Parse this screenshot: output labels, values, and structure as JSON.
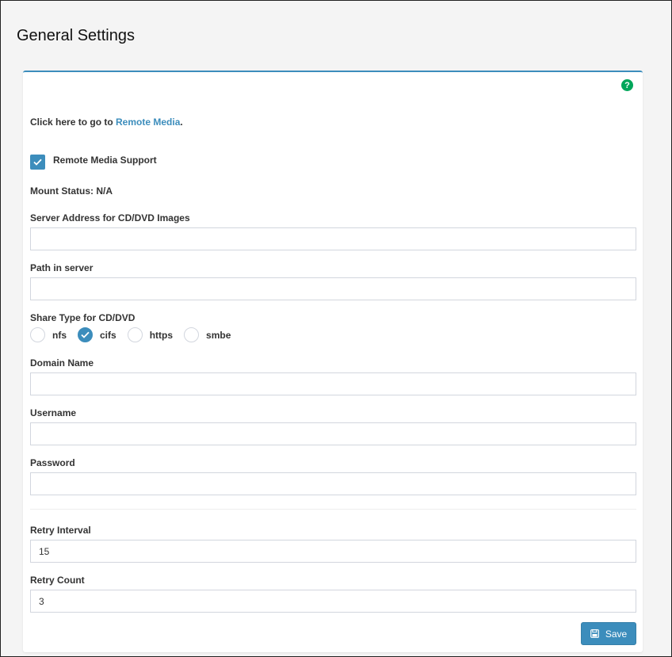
{
  "page": {
    "title": "General Settings"
  },
  "card": {
    "help_icon": "question-circle-icon",
    "link_prefix": "Click here to go to ",
    "link_text": "Remote Media",
    "link_suffix": ".",
    "remote_media_support": {
      "label": "Remote Media Support",
      "checked": true
    },
    "mount_status": "Mount Status: N/A",
    "fields": {
      "server_address": {
        "label": "Server Address for CD/DVD Images",
        "value": ""
      },
      "path_in_server": {
        "label": "Path in server",
        "value": ""
      },
      "domain_name": {
        "label": "Domain Name",
        "value": ""
      },
      "username": {
        "label": "Username",
        "value": ""
      },
      "password": {
        "label": "Password",
        "value": ""
      },
      "retry_interval": {
        "label": "Retry Interval",
        "value": "15"
      },
      "retry_count": {
        "label": "Retry Count",
        "value": "3"
      }
    },
    "share_type": {
      "label": "Share Type for CD/DVD",
      "options": [
        "nfs",
        "cifs",
        "https",
        "smbe"
      ],
      "selected": "cifs"
    },
    "save_label": "Save",
    "save_icon": "floppy-disk-icon"
  },
  "colors": {
    "accent": "#3c8dbc",
    "help": "#00a65a"
  }
}
